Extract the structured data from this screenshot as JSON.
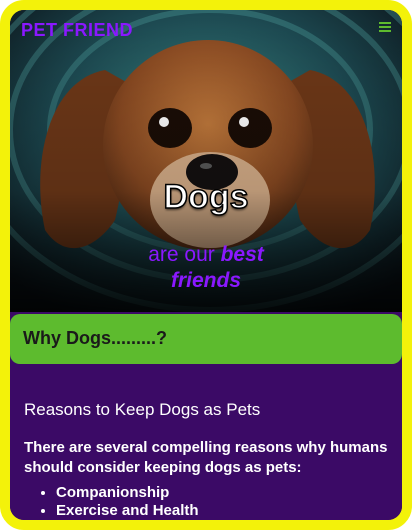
{
  "header": {
    "brand": "PET FRIEND",
    "menu_icon": "hamburger-menu-icon"
  },
  "hero": {
    "title": "Dogs",
    "subtitle_prefix": "are our",
    "subtitle_emphasis_1": "best",
    "subtitle_emphasis_2": "friends"
  },
  "why_bar": {
    "label": "Why Dogs.........?"
  },
  "content": {
    "heading": "Reasons to Keep Dogs as Pets",
    "intro": "There are several compelling reasons why humans should consider keeping dogs as pets:",
    "reasons": [
      "Companionship",
      "Exercise and Health"
    ]
  },
  "colors": {
    "frame": "#f3f20a",
    "brand": "#8a18ff",
    "green_bar": "#5dbb2e",
    "content_bg": "#3b0a66",
    "menu_icon": "#5dbb2e"
  }
}
